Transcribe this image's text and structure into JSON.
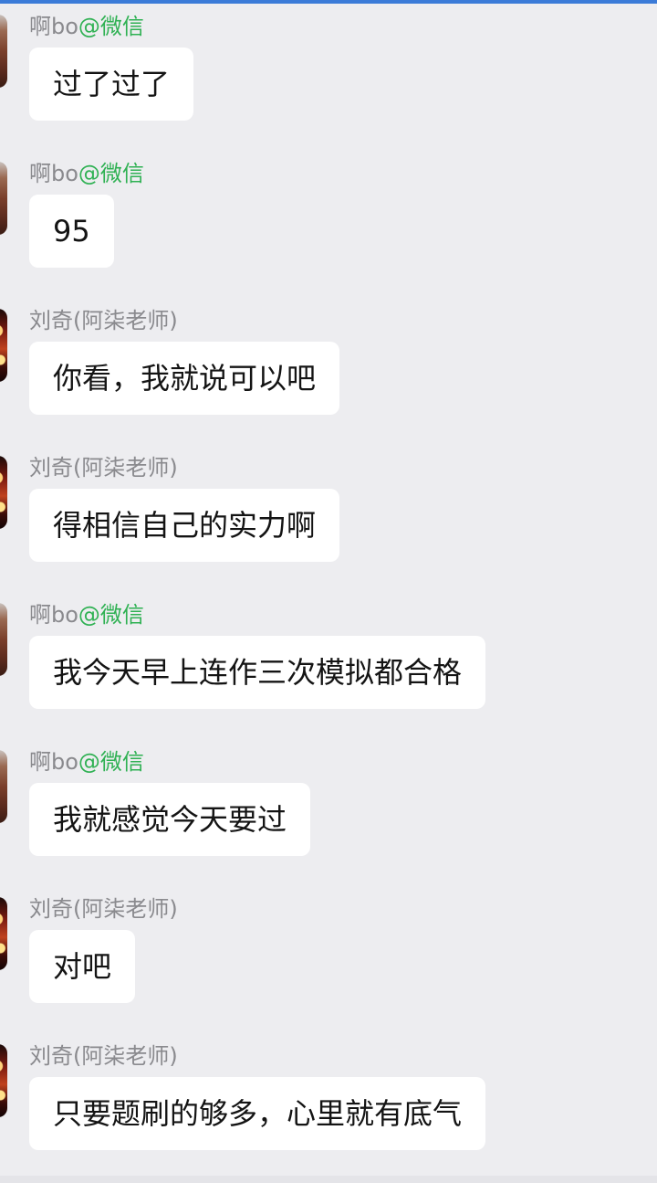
{
  "messages": [
    {
      "sender": "啊bo",
      "tag": "@微信",
      "avatar": "sender-avatar-bo",
      "text": "过了过了"
    },
    {
      "sender": "啊bo",
      "tag": "@微信",
      "avatar": "sender-avatar-bo",
      "text": "95"
    },
    {
      "sender": "刘奇(阿柒老师)",
      "tag": "",
      "avatar": "sender-avatar-teacher",
      "text": "你看，我就说可以吧"
    },
    {
      "sender": "刘奇(阿柒老师)",
      "tag": "",
      "avatar": "sender-avatar-teacher",
      "text": "得相信自己的实力啊"
    },
    {
      "sender": "啊bo",
      "tag": "@微信",
      "avatar": "sender-avatar-bo",
      "text": "我今天早上连作三次模拟都合格"
    },
    {
      "sender": "啊bo",
      "tag": "@微信",
      "avatar": "sender-avatar-bo",
      "text": "我就感觉今天要过"
    },
    {
      "sender": "刘奇(阿柒老师)",
      "tag": "",
      "avatar": "sender-avatar-teacher",
      "text": "对吧"
    },
    {
      "sender": "刘奇(阿柒老师)",
      "tag": "",
      "avatar": "sender-avatar-teacher",
      "text": "只要题刷的够多，心里就有底气"
    }
  ],
  "colors": {
    "background": "#ededf0",
    "bubble": "#ffffff",
    "sender_name": "#8a8a8e",
    "wechat_tag": "#2fb153",
    "message_text": "#141414"
  }
}
